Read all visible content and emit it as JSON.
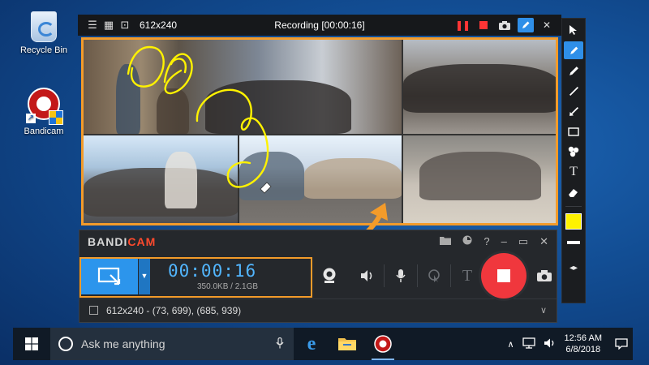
{
  "desktop": {
    "icons": [
      {
        "label": "Recycle Bin"
      },
      {
        "label": "Bandicam"
      }
    ]
  },
  "recording_window": {
    "size_label": "612x240",
    "status": "Recording [00:00:16]"
  },
  "bandicam": {
    "logo_part1": "BANDI",
    "logo_part2": "CAM",
    "timer": "00:00:16",
    "file_size": "350.0KB / 2.1GB",
    "region_text": "612x240 - (73, 699), (685, 939)"
  },
  "taskbar": {
    "search_placeholder": "Ask me anything",
    "time": "12:56 AM",
    "date": "6/8/2018"
  },
  "colors": {
    "accent_orange": "#f39b2a",
    "record_red": "#f0373d",
    "timer_blue": "#52b6ff",
    "mode_blue": "#2c95ec",
    "pen_yellow": "#fff200"
  },
  "icons": {
    "toolbar": [
      "cursor-icon",
      "pen-icon",
      "highlighter-icon",
      "line-icon",
      "arrow-icon",
      "rectangle-icon",
      "counter-icon",
      "text-icon",
      "eraser-icon"
    ]
  }
}
